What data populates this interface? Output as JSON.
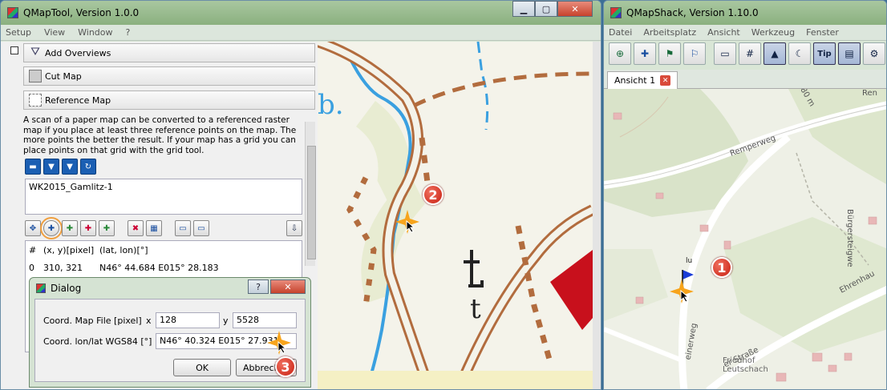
{
  "qmaptool": {
    "title": "QMapTool, Version 1.0.0",
    "menu": [
      "Setup",
      "View",
      "Window",
      "?"
    ],
    "toolbox": {
      "add_overviews": "Add Overviews",
      "cut_map": "Cut Map",
      "reference_map": "Reference Map"
    },
    "description": "A scan of a paper map can be converted to a referenced raster map if you place at least three reference points on the map. The more points the better the result. If your map has a grid you can place points on that grid with the grid tool.",
    "map_file": "WK2015_Gamlitz-1",
    "table": {
      "headers": [
        "#",
        "(x, y)[pixel]",
        "(lat, lon)[°]"
      ],
      "rows": [
        [
          "0",
          "310, 321",
          "N46° 44.684 E015° 28.183"
        ]
      ]
    },
    "map_badge": "2"
  },
  "dialog": {
    "title": "Dialog",
    "help": "?",
    "close": "✕",
    "coord_map_label": "Coord. Map File [pixel]",
    "x_label": "x",
    "x_value": "128",
    "y_label": "y",
    "y_value": "5528",
    "coord_lonlat_label": "Coord. lon/lat WGS84 [°]",
    "lonlat_value": "N46° 40.324 E015° 27.931",
    "ok": "OK",
    "cancel": "Abbrech",
    "badge": "3"
  },
  "qmapshack": {
    "title": "QMapShack, Version 1.10.0",
    "menu": [
      "Datei",
      "Arbeitsplatz",
      "Ansicht",
      "Werkzeug",
      "Fenster"
    ],
    "tab": "Ansicht 1",
    "map_labels": {
      "street1": "Remperweg",
      "street2": "Bürgersteigwe",
      "street3": "Ehrenhau",
      "street4": "einerweg",
      "street5": "Ren",
      "poi": "Friedhof",
      "place": "Leutschach",
      "elevation": "380 m",
      "street6": "er Straße",
      "flag_label": "lu"
    },
    "badge": "1"
  }
}
